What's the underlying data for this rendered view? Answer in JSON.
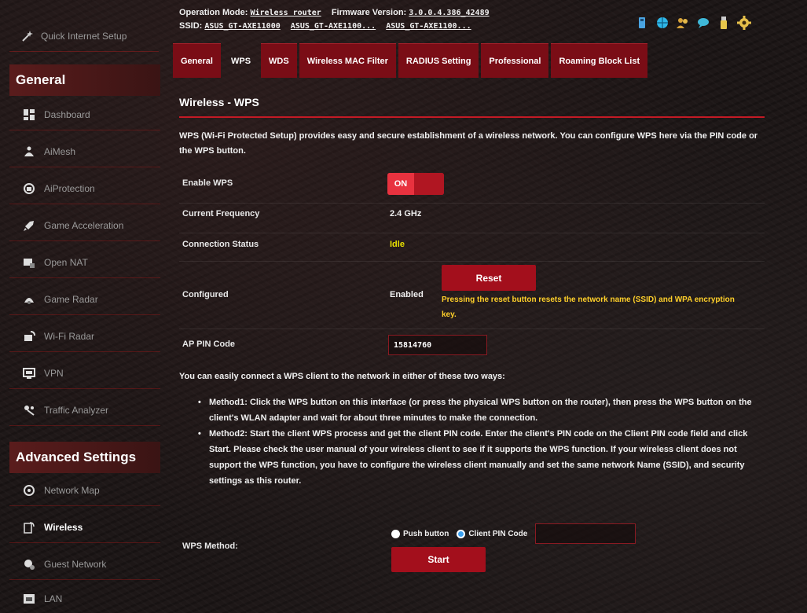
{
  "header": {
    "operation_mode_label": "Operation Mode:",
    "operation_mode_value": "Wireless router",
    "firmware_label": "Firmware Version:",
    "firmware_value": "3.0.0.4.386_42489",
    "ssid_label": "SSID:",
    "ssids": [
      "ASUS_GT-AXE11000",
      "ASUS_GT-AXE1100...",
      "ASUS_GT-AXE1100..."
    ]
  },
  "status_icons": [
    "usb-icon",
    "globe-icon",
    "users-icon",
    "chat-icon",
    "usb-stick-icon",
    "gear-icon"
  ],
  "sidebar": {
    "quick_setup": "Quick Internet Setup",
    "general_heading": "General",
    "general_items": [
      {
        "label": "Dashboard",
        "icon": "dashboard-icon"
      },
      {
        "label": "AiMesh",
        "icon": "aimesh-icon"
      },
      {
        "label": "AiProtection",
        "icon": "aiprotection-icon"
      },
      {
        "label": "Game Acceleration",
        "icon": "rocket-icon"
      },
      {
        "label": "Open NAT",
        "icon": "open-nat-icon"
      },
      {
        "label": "Game Radar",
        "icon": "radar-icon"
      },
      {
        "label": "Wi-Fi Radar",
        "icon": "wifi-radar-icon"
      },
      {
        "label": "VPN",
        "icon": "vpn-icon"
      },
      {
        "label": "Traffic Analyzer",
        "icon": "traffic-icon"
      }
    ],
    "advanced_heading": "Advanced Settings",
    "advanced_items": [
      {
        "label": "Network Map",
        "icon": "network-map-icon"
      },
      {
        "label": "Wireless",
        "icon": "wireless-icon"
      },
      {
        "label": "Guest Network",
        "icon": "guest-network-icon"
      },
      {
        "label": "LAN",
        "icon": "lan-icon"
      }
    ]
  },
  "tabs": [
    "General",
    "WPS",
    "WDS",
    "Wireless MAC Filter",
    "RADIUS Setting",
    "Professional",
    "Roaming Block List"
  ],
  "active_tab": "WPS",
  "main": {
    "title": "Wireless - WPS",
    "description": "WPS (Wi-Fi Protected Setup) provides easy and secure establishment of a wireless network. You can configure WPS here via the PIN code or the WPS button.",
    "enable_wps_label": "Enable WPS",
    "enable_wps_toggle": "ON",
    "current_frequency_label": "Current Frequency",
    "current_frequency_value": "2.4 GHz",
    "connection_status_label": "Connection Status",
    "connection_status_value": "Idle",
    "configured_label": "Configured",
    "configured_value": "Enabled",
    "reset_button": "Reset",
    "reset_note": "Pressing the reset button resets the network name (SSID) and WPA encryption key.",
    "ap_pin_label": "AP PIN Code",
    "ap_pin_value": "15814760",
    "methods_intro": "You can easily connect a WPS client to the network in either of these two ways:",
    "method1": "Method1: Click the WPS button on this interface (or press the physical WPS button on the router), then press the WPS button on the client's WLAN adapter and wait for about three minutes to make the connection.",
    "method2": "Method2: Start the client WPS process and get the client PIN code. Enter the client's PIN code on the Client PIN code field and click Start. Please check the user manual of your wireless client to see if it supports the WPS function. If your wireless client does not support the WPS function, you have to configure the wireless client manually and set the same network Name (SSID), and security settings as this router.",
    "wps_method_label": "WPS Method:",
    "push_button_label": "Push button",
    "client_pin_label": "Client PIN Code",
    "client_pin_value": "",
    "start_button": "Start"
  },
  "colors": {
    "accent_red": "#a30f1c",
    "toggle_red": "#d31c2b",
    "warning_yellow": "#ffd02a",
    "status_yellow": "#e8e000"
  }
}
